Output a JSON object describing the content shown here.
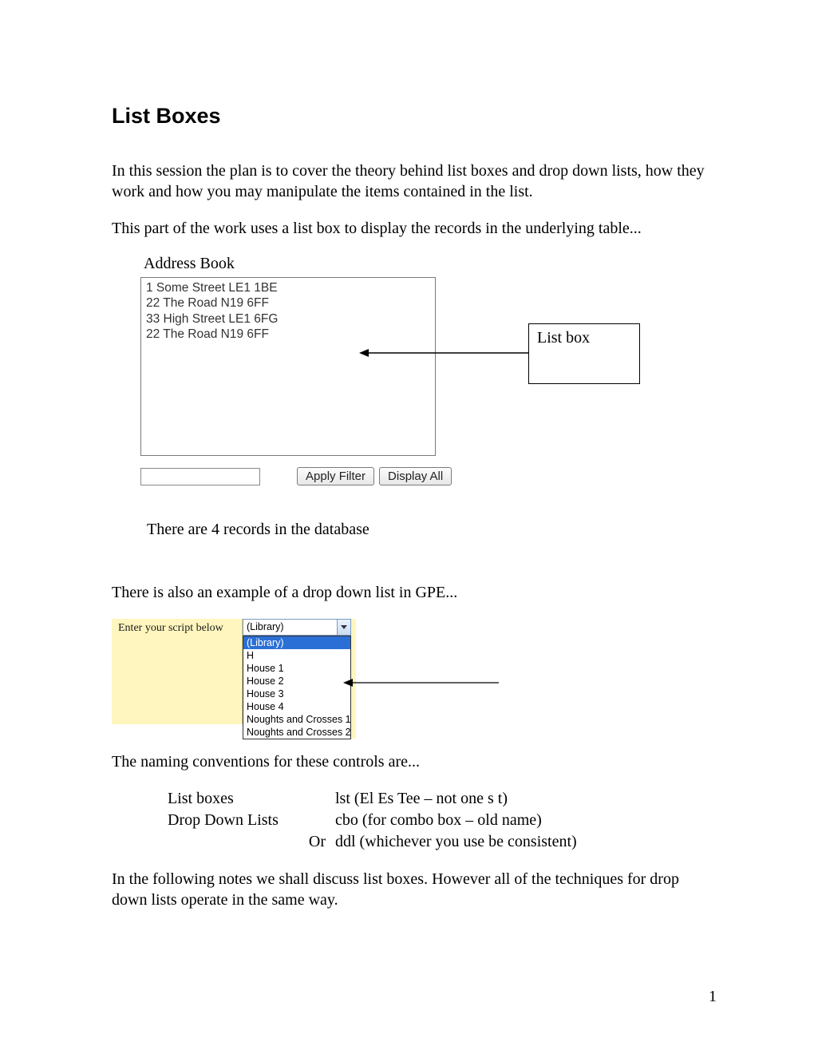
{
  "title": "List Boxes",
  "para1": "In this session the plan is to cover the theory behind list boxes and drop down lists, how they work and how you may manipulate the items contained in the list.",
  "para2": "This part of the work uses a list box to display the records in the underlying table...",
  "address_book": {
    "heading": "Address Book",
    "items": [
      "1 Some Street LE1 1BE",
      "22 The Road N19 6FF",
      "33 High Street LE1 6FG",
      "22 The Road N19 6FF"
    ],
    "apply_filter_label": "Apply Filter",
    "display_all_label": "Display All",
    "filter_value": "",
    "records_msg": "There are 4 records in the database",
    "callout_label": "List box"
  },
  "para3": "There is also an example of a drop down list in GPE...",
  "gpe": {
    "left_label": "Enter your script below",
    "selected": "(Library)",
    "options": [
      "(Library)",
      "H",
      "House 1",
      "House 2",
      "House 3",
      "House 4",
      "Noughts and Crosses 1",
      "Noughts and Crosses 2"
    ]
  },
  "para4": "The naming conventions for these controls are...",
  "conventions": {
    "r1c1": "List boxes",
    "r1c2": "lst (El Es Tee – not one s t)",
    "r2c1": "Drop Down Lists",
    "r2c2": "cbo (for combo box – old name)",
    "r3c1": "Or",
    "r3c2": "ddl (whichever you use be consistent)"
  },
  "para5": "In the following notes we shall discuss list boxes. However all of the techniques for drop down lists operate in the same way.",
  "page_number": "1"
}
